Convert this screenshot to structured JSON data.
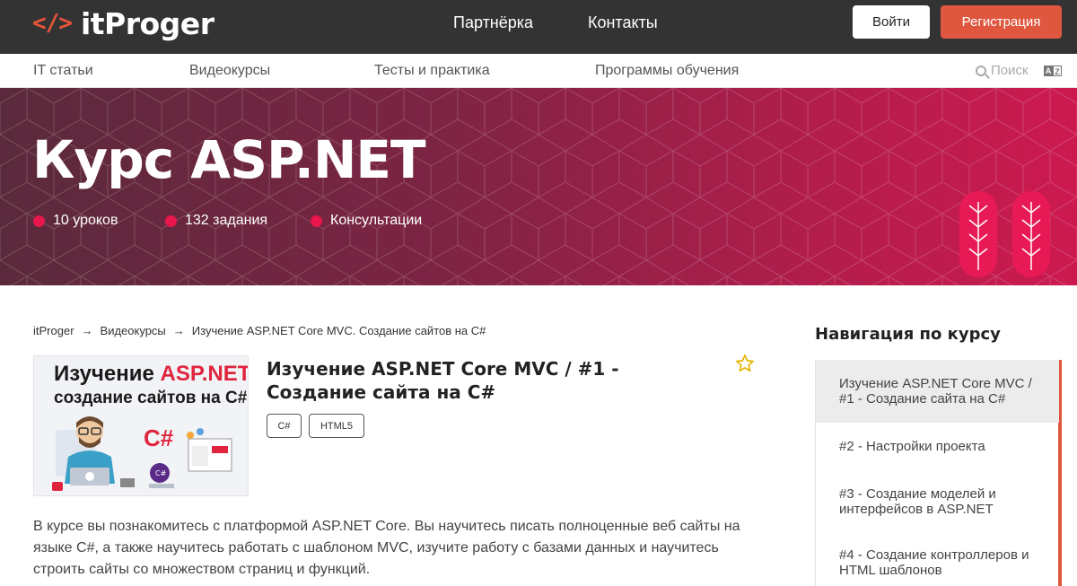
{
  "header": {
    "logo_mark": "</>",
    "logo_text": "itProger",
    "links": [
      "Партнёрка",
      "Контакты"
    ],
    "login_label": "Войти",
    "register_label": "Регистрация"
  },
  "subnav": {
    "items": [
      "IT статьи",
      "Видеокурсы",
      "Тесты и практика",
      "Программы обучения"
    ],
    "search_label": "Поиск",
    "lang_icon": "language-switch-icon"
  },
  "hero": {
    "title": "Курс ASP.NET",
    "meta": [
      "10 уроков",
      "132 задания",
      "Консультации"
    ]
  },
  "breadcrumb": [
    "itProger",
    "Видеокурсы",
    "Изучение ASP.NET Core MVC. Создание сайтов на C#"
  ],
  "course": {
    "thumb_title_part1": "Изучение ",
    "thumb_title_part2": "ASP.NET",
    "thumb_subtitle": "создание сайтов на C#",
    "thumb_csharp": "C#",
    "title": "Изучение ASP.NET Core MVC / #1 - Создание сайта на C#",
    "tags": [
      "C#",
      "HTML5"
    ],
    "description": "В курсе вы познакомитесь с платформой ASP.NET Core. Вы научитесь писать полноценные веб сайты на языке C#, а также научитесь работать с шаблоном MVC, изучите работу с базами данных и научитесь строить сайты со множеством страниц и функций."
  },
  "course_nav": {
    "heading": "Навигация по курсу",
    "items": [
      "Изучение ASP.NET Core MVC / #1 - Создание сайта на C#",
      "#2 - Настройки проекта",
      "#3 - Создание моделей и интерфейсов в ASP.NET",
      "#4 - Создание контроллеров и HTML шаблонов"
    ]
  },
  "colors": {
    "header_bg": "#333333",
    "accent": "#e0573f",
    "hero_dot": "#e8164a"
  }
}
